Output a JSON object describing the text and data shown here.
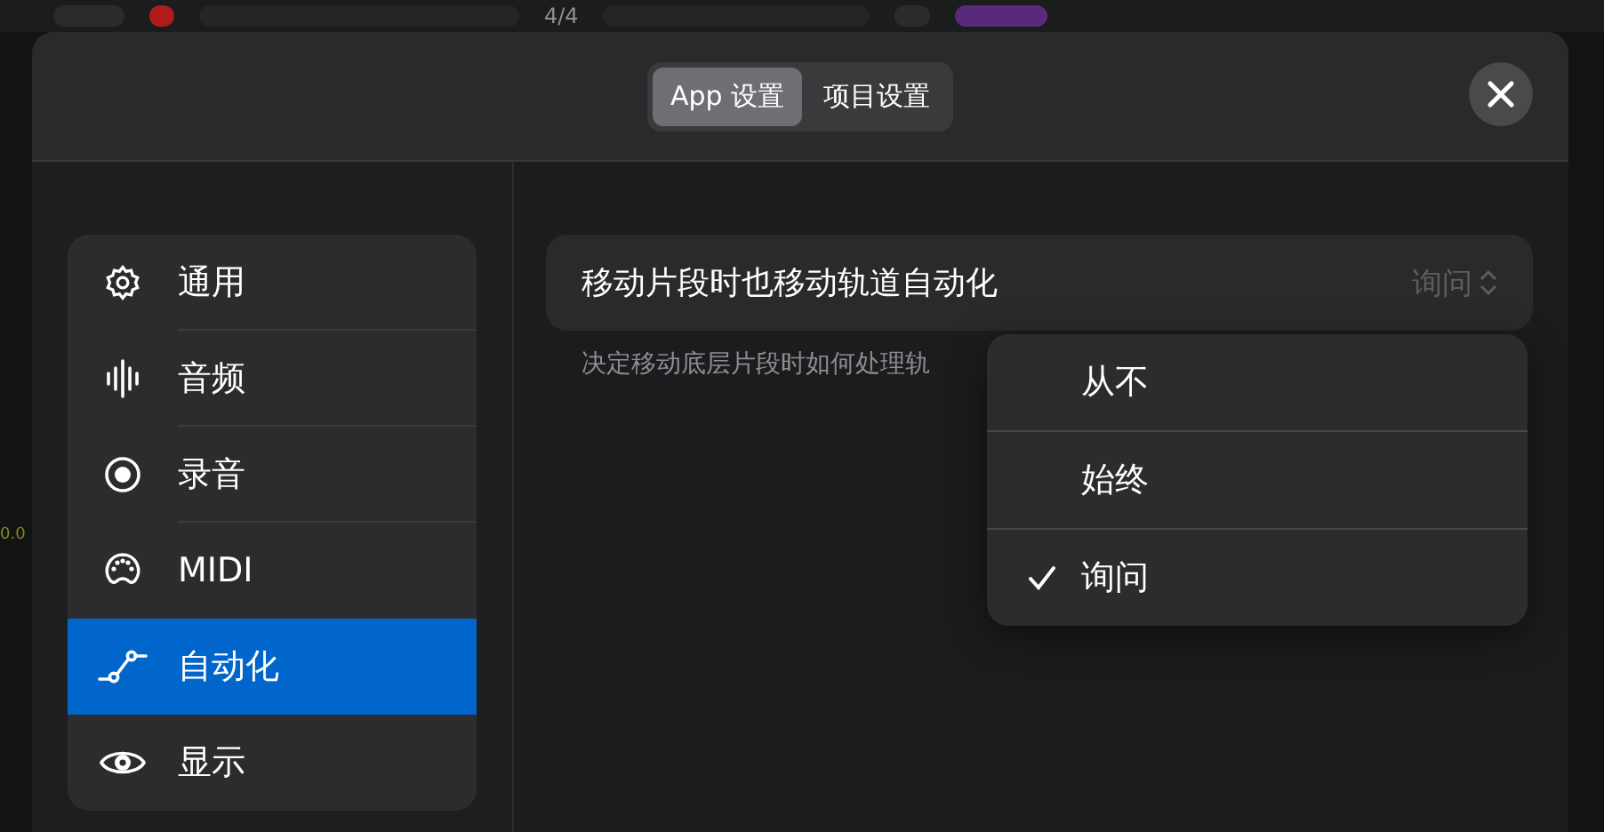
{
  "background": {
    "time_signature": "4/4",
    "side_reading": "0.0"
  },
  "tabs": [
    {
      "label": "App 设置",
      "selected": true
    },
    {
      "label": "项目设置",
      "selected": false
    }
  ],
  "sidebar": {
    "items": [
      {
        "label": "通用",
        "selected": false
      },
      {
        "label": "音频",
        "selected": false
      },
      {
        "label": "录音",
        "selected": false
      },
      {
        "label": "MIDI",
        "selected": false
      },
      {
        "label": "自动化",
        "selected": true
      },
      {
        "label": "显示",
        "selected": false
      }
    ]
  },
  "setting": {
    "label": "移动片段时也移动轨道自动化",
    "value": "询问",
    "description": "决定移动底层片段时如何处理轨"
  },
  "menu": {
    "options": [
      {
        "label": "从不",
        "checked": false
      },
      {
        "label": "始终",
        "checked": false
      },
      {
        "label": "询问",
        "checked": true
      }
    ]
  }
}
